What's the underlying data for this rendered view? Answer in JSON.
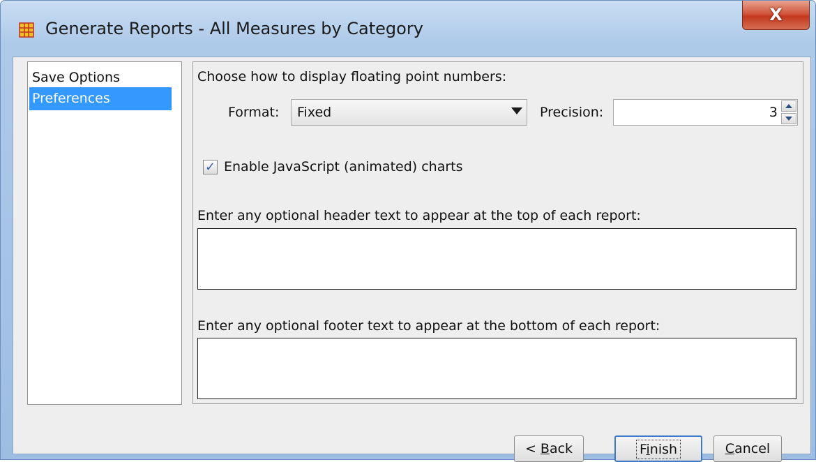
{
  "window": {
    "title": "Generate Reports - All Measures by Category",
    "icon": "app-grid-icon",
    "close_label": "X"
  },
  "sidebar": {
    "items": [
      {
        "label": "Save Options",
        "selected": false
      },
      {
        "label": "Preferences",
        "selected": true
      }
    ]
  },
  "preferences": {
    "float_heading": "Choose how to display floating point numbers:",
    "format_label": "Format:",
    "format_value": "Fixed",
    "precision_label": "Precision:",
    "precision_value": "3",
    "js_charts_label": "Enable JavaScript (animated) charts",
    "js_charts_checked": true,
    "header_label": "Enter any optional header text to appear at the top of each report:",
    "header_value": "",
    "footer_label": "Enter any optional footer text to appear at the bottom of each report:",
    "footer_value": ""
  },
  "buttons": {
    "back": {
      "prefix": "< ",
      "mnemonic": "B",
      "rest": "ack"
    },
    "finish": {
      "prefix": "F",
      "mnemonic": "i",
      "rest": "nish"
    },
    "cancel": {
      "prefix": "",
      "mnemonic": "C",
      "rest": "ancel"
    }
  },
  "colors": {
    "selection": "#3399ff",
    "close_button": "#c3381f",
    "title_bar": "#aecae9"
  }
}
